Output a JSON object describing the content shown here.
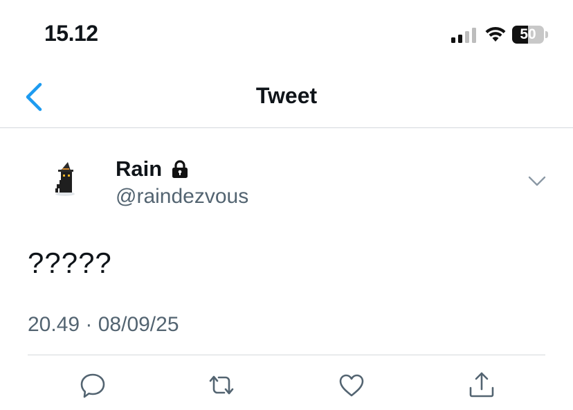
{
  "status_bar": {
    "time": "15.12",
    "battery_level": "50",
    "battery_fraction": 0.5,
    "signal_bars_active": 2,
    "signal_bars_total": 4
  },
  "nav": {
    "title": "Tweet"
  },
  "tweet": {
    "author_name": "Rain",
    "author_handle": "@raindezvous",
    "protected": true,
    "text": "?????",
    "timestamp": "20.49 · 08/09/25"
  },
  "colors": {
    "accent": "#1d9bf0",
    "text_primary": "#0f1419",
    "text_secondary": "#536471",
    "divider": "#d4d8dc"
  },
  "icons": {
    "back": "chevron-left-icon",
    "lock": "lock-icon",
    "more": "chevron-down-icon",
    "reply": "reply-icon",
    "retweet": "retweet-icon",
    "like": "heart-icon",
    "share": "share-icon"
  }
}
